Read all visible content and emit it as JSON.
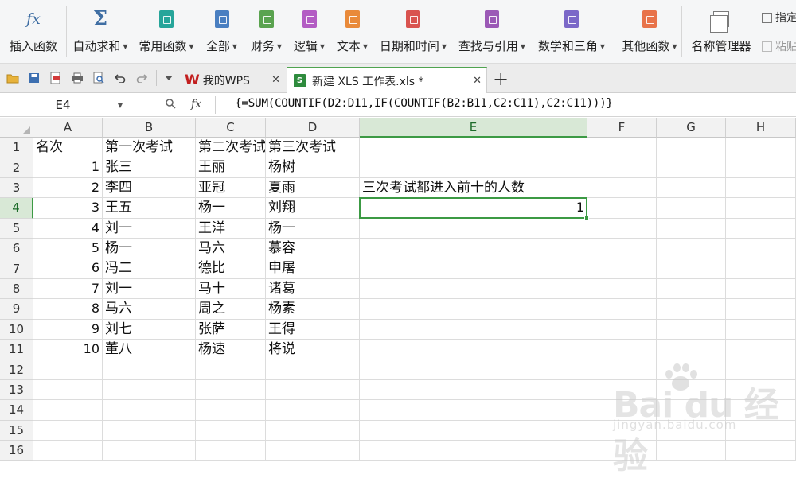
{
  "ribbon": {
    "buttons": [
      {
        "label": "插入函数",
        "icon": "fx-icon"
      },
      {
        "label": "自动求和",
        "icon": "sigma-icon",
        "dropdown": true
      },
      {
        "label": "常用函数",
        "icon": "star-book-icon",
        "dropdown": true
      },
      {
        "label": "全部",
        "icon": "list-book-icon",
        "dropdown": true
      },
      {
        "label": "财务",
        "icon": "finance-book-icon",
        "dropdown": true
      },
      {
        "label": "逻辑",
        "icon": "logic-book-icon",
        "dropdown": true
      },
      {
        "label": "文本",
        "icon": "text-book-icon",
        "dropdown": true
      },
      {
        "label": "日期和时间",
        "icon": "clock-book-icon",
        "dropdown": true
      },
      {
        "label": "查找与引用",
        "icon": "lookup-book-icon",
        "dropdown": true
      },
      {
        "label": "数学和三角",
        "icon": "math-book-icon",
        "dropdown": true
      },
      {
        "label": "其他函数",
        "icon": "more-book-icon",
        "dropdown": true
      },
      {
        "label": "名称管理器",
        "icon": "name-manager-icon"
      }
    ],
    "side_top": "指定",
    "side_bottom": "粘贴"
  },
  "colors": {
    "finance": "#5aa34f",
    "star": "#26a59a",
    "list": "#4a7fc1",
    "logic": "#b35cc4",
    "text": "#e98a3a",
    "clock": "#d9534f",
    "lookup": "#9b59b6",
    "math": "#7b68c8",
    "more": "#e8734a",
    "accent": "#3c9a44"
  },
  "tabs": {
    "home": "我的WPS",
    "active": "新建 XLS 工作表.xls *"
  },
  "formula_bar": {
    "name_box": "E4",
    "formula": "{=SUM(COUNTIF(D2:D11,IF(COUNTIF(B2:B11,C2:C11),C2:C11)))}"
  },
  "sheet": {
    "columns": [
      "A",
      "B",
      "C",
      "D",
      "E",
      "F",
      "G",
      "H"
    ],
    "rows": [
      "1",
      "2",
      "3",
      "4",
      "5",
      "6",
      "7",
      "8",
      "9",
      "10",
      "11",
      "12",
      "13",
      "14",
      "15",
      "16"
    ],
    "headers": [
      "名次",
      "第一次考试",
      "第二次考试",
      "第三次考试"
    ],
    "data": [
      [
        "1",
        "张三",
        "王丽",
        "杨树"
      ],
      [
        "2",
        "李四",
        "亚冠",
        "夏雨"
      ],
      [
        "3",
        "王五",
        "杨一",
        "刘翔"
      ],
      [
        "4",
        "刘一",
        "王洋",
        "杨一"
      ],
      [
        "5",
        "杨一",
        "马六",
        "慕容"
      ],
      [
        "6",
        "冯二",
        "德比",
        "申屠"
      ],
      [
        "7",
        "刘一",
        "马十",
        "诸葛"
      ],
      [
        "8",
        "马六",
        "周之",
        "杨素"
      ],
      [
        "9",
        "刘七",
        "张萨",
        "王得"
      ],
      [
        "10",
        "董八",
        "杨速",
        "将说"
      ]
    ],
    "e3": "三次考试都进入前十的人数",
    "e4": "1"
  },
  "watermark": {
    "brand": "Bai du 经验",
    "url": "jingyan.baidu.com"
  }
}
